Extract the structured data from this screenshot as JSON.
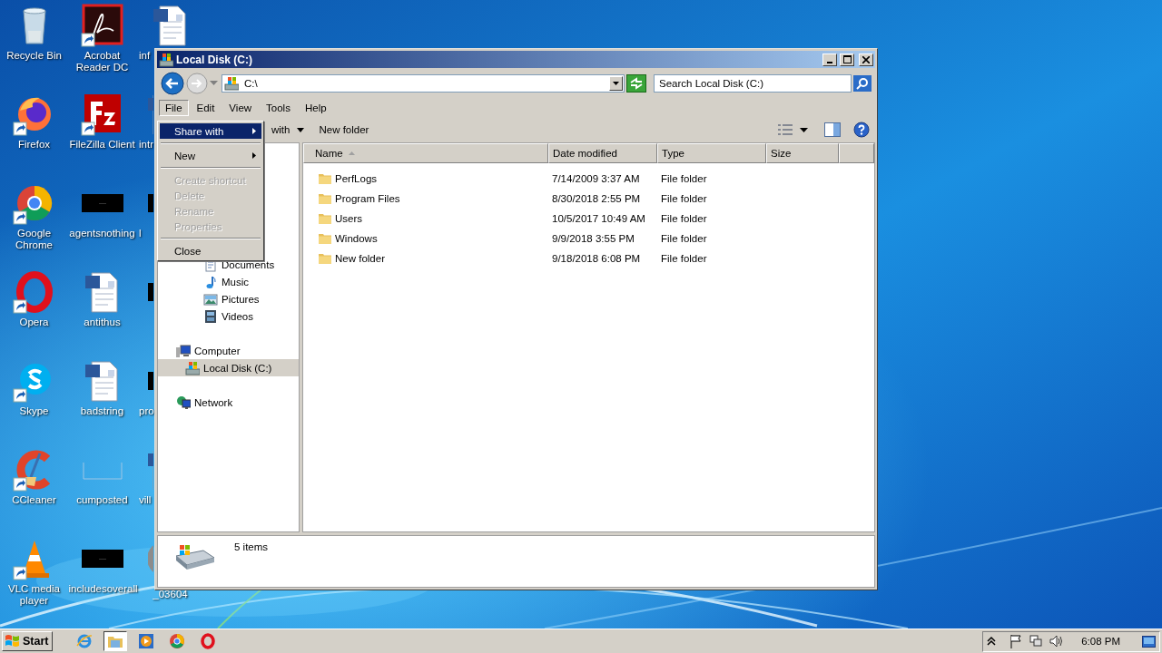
{
  "desktop": {
    "icons": [
      {
        "label": "Recycle Bin",
        "kind": "recycle",
        "shortcut": false
      },
      {
        "label": "Firefox",
        "kind": "firefox",
        "shortcut": true
      },
      {
        "label": "Google Chrome",
        "kind": "chrome",
        "shortcut": true
      },
      {
        "label": "Opera",
        "kind": "opera",
        "shortcut": true
      },
      {
        "label": "Skype",
        "kind": "skype",
        "shortcut": true
      },
      {
        "label": "CCleaner",
        "kind": "ccleaner",
        "shortcut": true
      },
      {
        "label": "VLC media player",
        "kind": "vlc",
        "shortcut": true
      },
      {
        "label": "Acrobat Reader DC",
        "kind": "pdf",
        "shortcut": true
      },
      {
        "label": "FileZilla Client",
        "kind": "filezilla",
        "shortcut": true
      },
      {
        "label": "agentsnothing",
        "kind": "black",
        "shortcut": false
      },
      {
        "label": "antithus",
        "kind": "word",
        "shortcut": false
      },
      {
        "label": "badstring",
        "kind": "word",
        "shortcut": false
      },
      {
        "label": "cumposted",
        "kind": "blank",
        "shortcut": false
      },
      {
        "label": "includesoverall",
        "kind": "black",
        "shortcut": false
      },
      {
        "label": "inf",
        "kind": "word",
        "shortcut": false
      },
      {
        "label": "intr",
        "kind": "word",
        "shortcut": false
      },
      {
        "label": "l",
        "kind": "black",
        "shortcut": false
      },
      {
        "kind": "black",
        "shortcut": false
      },
      {
        "label": "pro",
        "kind": "black",
        "shortcut": false
      },
      {
        "label": "vill",
        "kind": "word",
        "shortcut": false
      },
      {
        "label": "_03604",
        "kind": "disc",
        "shortcut": false
      }
    ]
  },
  "window": {
    "title": "Local Disk (C:)",
    "address": "C:\\",
    "search": {
      "placeholder": "Search Local Disk (C:)"
    },
    "menu_bar": [
      {
        "label": "File",
        "selected": true
      },
      {
        "label": "Edit",
        "selected": false
      },
      {
        "label": "View",
        "selected": false
      },
      {
        "label": "Tools",
        "selected": false
      },
      {
        "label": "Help",
        "selected": false
      }
    ],
    "file_menu": [
      {
        "kind": "item",
        "label": "Share with",
        "submenu": true,
        "disabled": false,
        "selected": true
      },
      {
        "kind": "separator"
      },
      {
        "kind": "item",
        "label": "New",
        "submenu": true,
        "disabled": false,
        "selected": false
      },
      {
        "kind": "separator"
      },
      {
        "kind": "item",
        "label": "Create shortcut",
        "submenu": false,
        "disabled": true,
        "selected": false
      },
      {
        "kind": "item",
        "label": "Delete",
        "submenu": false,
        "disabled": true,
        "selected": false
      },
      {
        "kind": "item",
        "label": "Rename",
        "submenu": false,
        "disabled": true,
        "selected": false
      },
      {
        "kind": "item",
        "label": "Properties",
        "submenu": false,
        "disabled": true,
        "selected": false
      },
      {
        "kind": "separator"
      },
      {
        "kind": "item",
        "label": "Close",
        "submenu": false,
        "disabled": false,
        "selected": false
      }
    ],
    "toolbar": [
      {
        "label": "with",
        "dropdown": true
      },
      {
        "label": "New folder",
        "dropdown": false
      }
    ],
    "nav_pane": [
      {
        "children": [
          {
            "label": "Documents",
            "kind": "documents",
            "selected": false
          },
          {
            "label": "Music",
            "kind": "music",
            "selected": false
          },
          {
            "label": "Pictures",
            "kind": "pictures",
            "selected": false
          },
          {
            "label": "Videos",
            "kind": "videos",
            "selected": false
          }
        ]
      },
      {
        "label": "Computer",
        "kind": "computer",
        "selected": false,
        "children": [
          {
            "label": "Local Disk (C:)",
            "kind": "drive",
            "selected": true
          }
        ]
      },
      {
        "label": "Network",
        "kind": "network",
        "selected": false
      }
    ],
    "columns": [
      {
        "label": "Name",
        "sorted": true
      },
      {
        "label": "Date modified",
        "sorted": false
      },
      {
        "label": "Type",
        "sorted": false
      },
      {
        "label": "Size",
        "sorted": false
      }
    ],
    "rows": [
      {
        "name": "PerfLogs",
        "date_modified": "7/14/2009 3:37 AM",
        "type": "File folder"
      },
      {
        "name": "Program Files",
        "date_modified": "8/30/2018 2:55 PM",
        "type": "File folder"
      },
      {
        "name": "Users",
        "date_modified": "10/5/2017 10:49 AM",
        "type": "File folder"
      },
      {
        "name": "Windows",
        "date_modified": "9/9/2018 3:55 PM",
        "type": "File folder"
      },
      {
        "name": "New folder",
        "date_modified": "9/18/2018 6:08 PM",
        "type": "File folder"
      }
    ],
    "status": "5 items"
  },
  "taskbar": {
    "start": "Start",
    "apps": [
      {
        "kind": "ie",
        "selected": false
      },
      {
        "kind": "explorer",
        "selected": true
      },
      {
        "kind": "media",
        "selected": false
      },
      {
        "kind": "chrome",
        "selected": false
      },
      {
        "kind": "opera",
        "selected": false
      }
    ],
    "clock": "6:08 PM"
  }
}
